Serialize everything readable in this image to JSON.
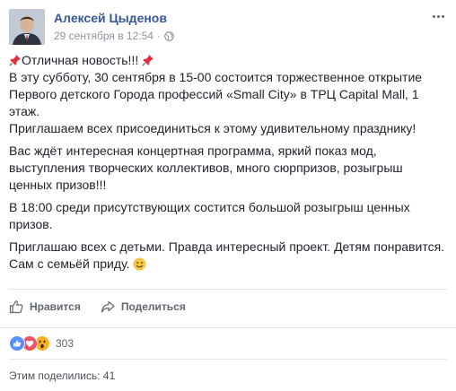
{
  "post": {
    "author": "Алексей Цыденов",
    "timestamp": "29 сентября в 12:54",
    "separator": "·",
    "privacy_icon": "globe-icon",
    "menu_icon": "more-icon",
    "content": {
      "title": "Отличная новость!!!",
      "p1": "В эту субботу, 30 сентября в 15-00 состоится торжественное открытие Первого детского Города профессий «Small City» в ТРЦ Capital Mall, 1 этаж.",
      "p1b": "Приглашаем всех присоединиться к этому удивительному празднику!",
      "p2": "Вас ждёт интересная концертная программа, яркий показ мод, выступления творческих коллективов, много сюрпризов, розыгрыш ценных призов!!!",
      "p3": "В 18:00 среди присутствующих состится большой розыгрыш ценных призов.",
      "p4": "Приглашаю всех с детьми. Правда интересный проект. Детям понравится. Сам с семьёй приду."
    },
    "actions": {
      "like_label": "Нравится",
      "share_label": "Поделиться"
    },
    "reactions": {
      "types": [
        "like",
        "love",
        "wow"
      ],
      "count": "303"
    },
    "shares_text": "Этим поделились: 41"
  },
  "colors": {
    "link": "#365899",
    "meta": "#90949c",
    "text": "#1d2129",
    "action": "#606770",
    "like_blue": "#5890ff",
    "love_red": "#f25268",
    "wow_yellow": "#f7b125"
  }
}
